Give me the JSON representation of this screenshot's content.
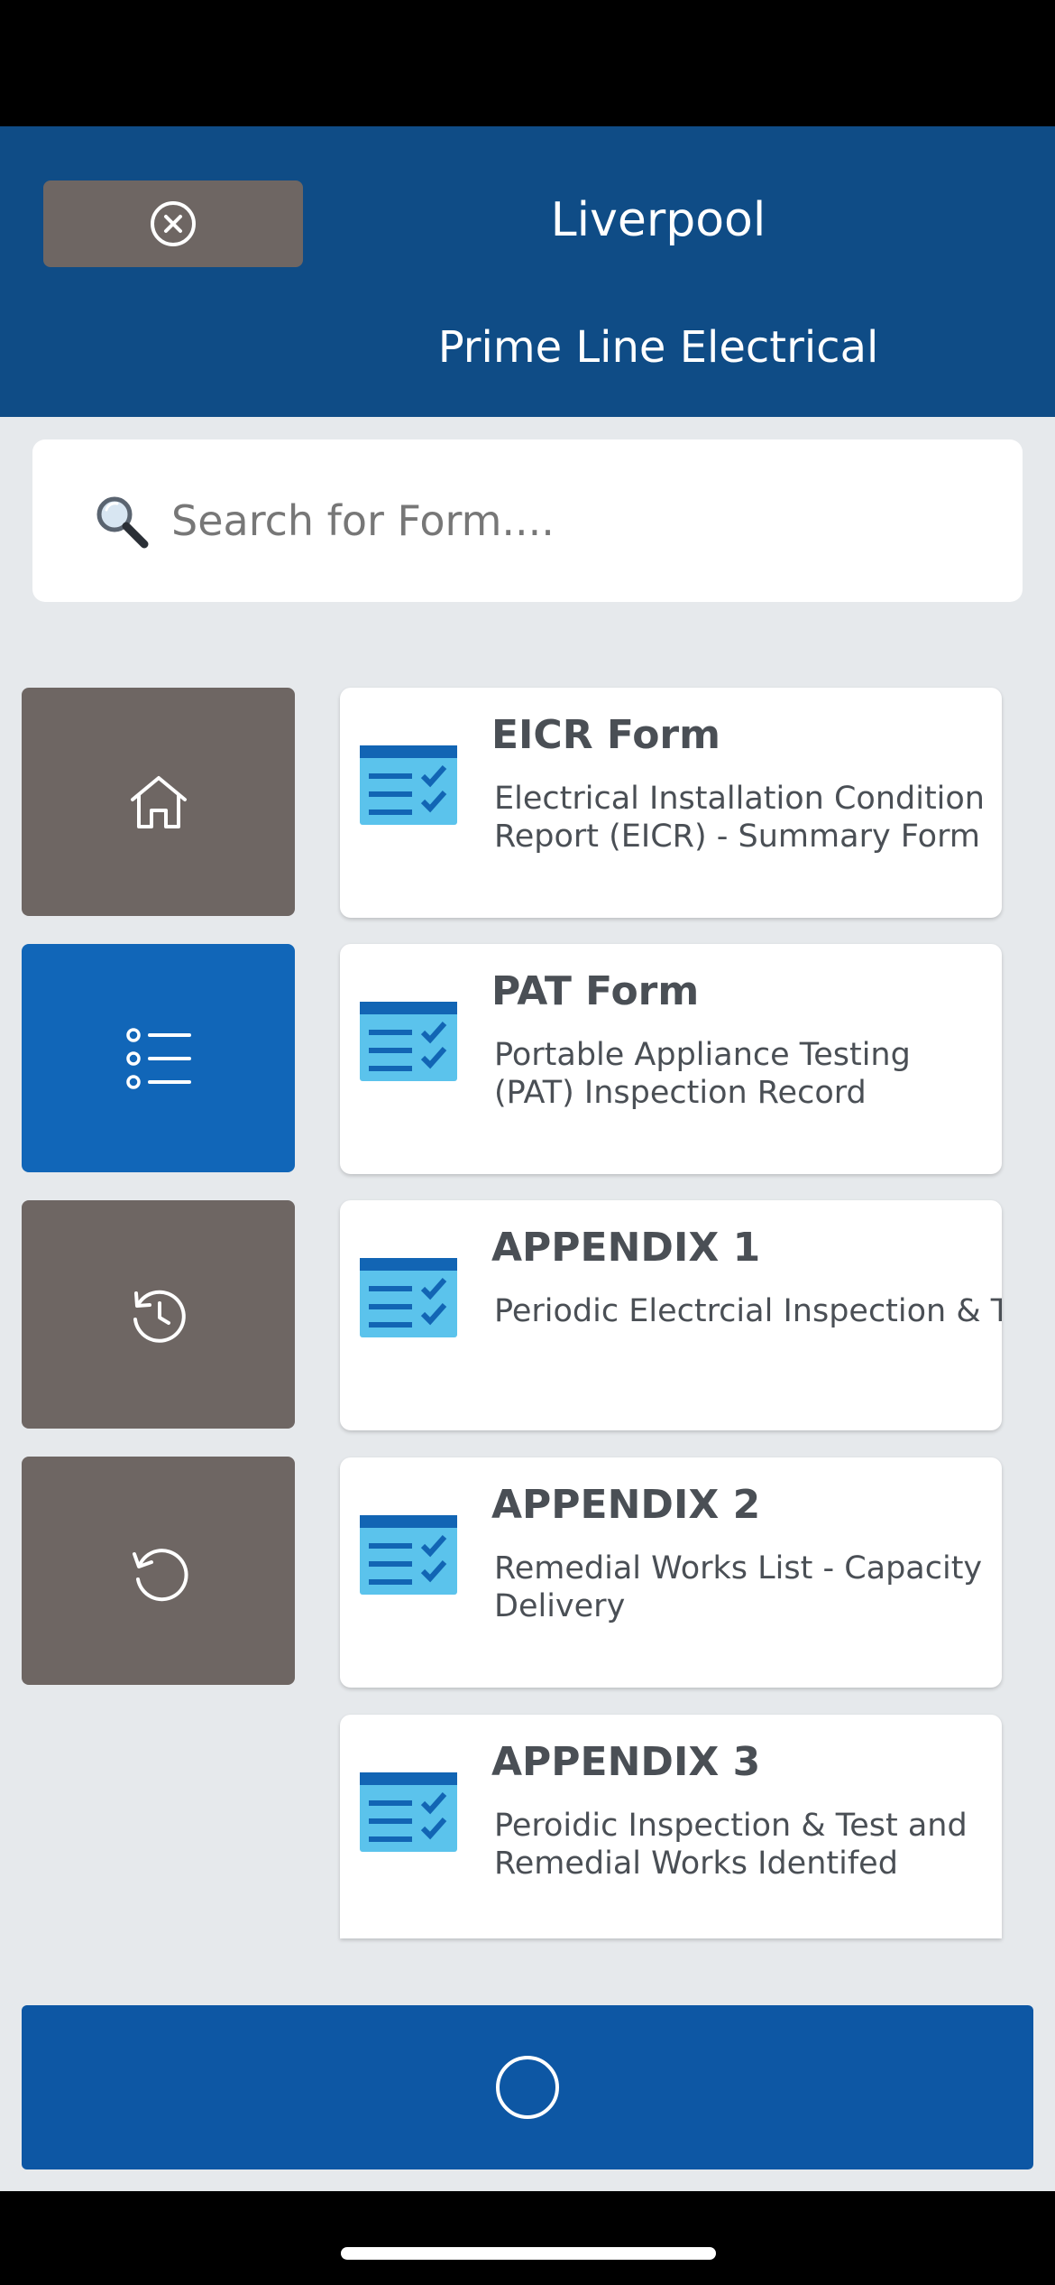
{
  "header": {
    "title": "Liverpool",
    "subtitle": "Prime Line Electrical",
    "close_icon": "close-circle-icon",
    "color": "#0f4c86"
  },
  "search": {
    "icon": "magnifier-icon",
    "placeholder": "Search for Form....",
    "value": ""
  },
  "nav": [
    {
      "name": "home",
      "icon": "home-icon",
      "active": false
    },
    {
      "name": "forms-list",
      "icon": "list-icon",
      "active": true
    },
    {
      "name": "history",
      "icon": "history-icon",
      "active": false
    },
    {
      "name": "undo",
      "icon": "undo-icon",
      "active": false
    }
  ],
  "forms": [
    {
      "title": "EICR Form",
      "description": "Electrical Installation Condition Report (EICR) - Summary Form",
      "icon": "form-checklist-icon"
    },
    {
      "title": "PAT Form",
      "description": "Portable Appliance Testing (PAT) Inspection Record",
      "icon": "form-checklist-icon"
    },
    {
      "title": "APPENDIX 1",
      "description": "Periodic Electrcial Inspection & Test",
      "icon": "form-checklist-icon"
    },
    {
      "title": "APPENDIX 2",
      "description": "Remedial Works List - Capacity Delivery",
      "icon": "form-checklist-icon"
    },
    {
      "title": "APPENDIX 3",
      "description": "Peroidic Inspection & Test and Remedial Works Identifed",
      "icon": "form-checklist-icon"
    }
  ],
  "bottom_bar": {
    "icon": "circle-icon"
  },
  "colors": {
    "accent": "#1166b8",
    "nav_inactive": "#6e6663",
    "bottom_bar": "#0d57a4",
    "background": "#e6e9ec"
  }
}
